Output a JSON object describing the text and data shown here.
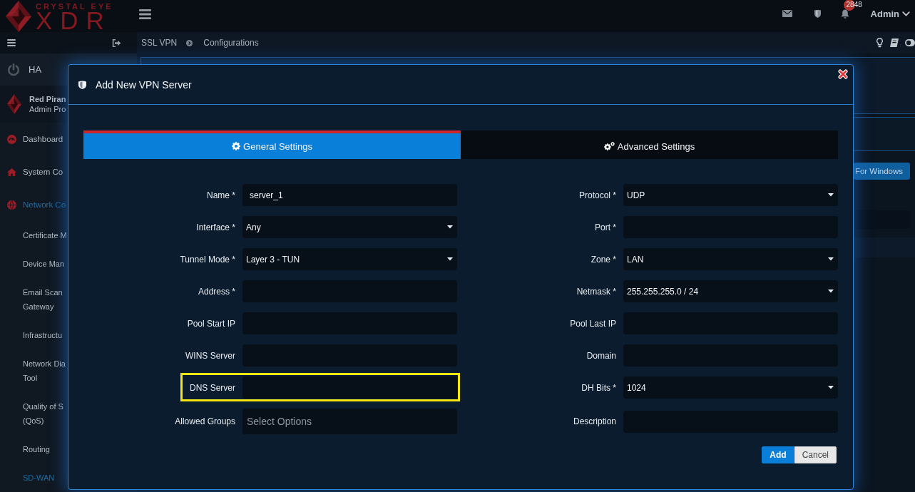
{
  "topbar": {
    "logo_tagline": "CRYSTAL EYE",
    "logo_wordmark": "XDR",
    "notification_count": "2848",
    "user_menu": "Admin"
  },
  "sidebar": {
    "status_item": "HA",
    "profile": {
      "name": "Red Piran",
      "role": "Admin Pro"
    },
    "menu": [
      {
        "label": "Dashboard",
        "selected": false
      },
      {
        "label": "System Co",
        "selected": false
      },
      {
        "label": "Network Co",
        "selected": true,
        "children": [
          {
            "lines": [
              "Certificate M"
            ],
            "selected": false
          },
          {
            "lines": [
              "Device Man"
            ],
            "selected": false
          },
          {
            "lines": [
              "Email Scan",
              "Gateway"
            ],
            "selected": false
          },
          {
            "lines": [
              "Infrastructu"
            ],
            "selected": false
          },
          {
            "lines": [
              "Network Dia",
              "Tool"
            ],
            "selected": false
          },
          {
            "lines": [
              "Quality of S",
              "(QoS)"
            ],
            "selected": false
          },
          {
            "lines": [
              "Routing"
            ],
            "selected": false
          },
          {
            "lines": [
              "SD-WAN"
            ],
            "selected": true
          }
        ]
      }
    ]
  },
  "breadcrumb": [
    "SSL VPN",
    "Configurations"
  ],
  "page": {
    "download_button": "For Windows"
  },
  "modal": {
    "title": "Add New VPN Server",
    "tabs": [
      {
        "label": "General Settings",
        "selected": true
      },
      {
        "label": "Advanced Settings",
        "selected": false
      }
    ],
    "left_fields": [
      {
        "label": "Name *",
        "kind": "text",
        "value": "server_1",
        "highlighted": false
      },
      {
        "label": "Interface *",
        "kind": "select",
        "value": "Any",
        "highlighted": false
      },
      {
        "label": "Tunnel Mode *",
        "kind": "select",
        "value": "Layer 3 - TUN",
        "highlighted": false
      },
      {
        "label": "Address *",
        "kind": "text",
        "highlighted": false
      },
      {
        "label": "Pool Start IP",
        "kind": "text",
        "highlighted": false
      },
      {
        "label": "WINS Server",
        "kind": "text",
        "highlighted": false
      },
      {
        "label": "DNS Server",
        "kind": "text",
        "highlighted": true
      },
      {
        "label": "Allowed Groups",
        "kind": "multiselect",
        "placeholder": "Select Options",
        "highlighted": false
      }
    ],
    "right_fields": [
      {
        "label": "Protocol *",
        "kind": "select",
        "value": "UDP",
        "highlighted": false
      },
      {
        "label": "Port *",
        "kind": "text",
        "highlighted": false
      },
      {
        "label": "Zone *",
        "kind": "select",
        "value": "LAN",
        "highlighted": false
      },
      {
        "label": "Netmask *",
        "kind": "select",
        "value": "255.255.255.0 / 24",
        "highlighted": false
      },
      {
        "label": "Pool Last IP",
        "kind": "text",
        "highlighted": false
      },
      {
        "label": "Domain",
        "kind": "text",
        "highlighted": false
      },
      {
        "label": "DH Bits *",
        "kind": "select",
        "value": "1024",
        "highlighted": false
      },
      {
        "label": "Description",
        "kind": "text",
        "highlighted": false
      }
    ],
    "buttons": [
      {
        "kind": "submit",
        "label": "Add"
      },
      {
        "kind": "cancel",
        "label": "Cancel"
      }
    ]
  }
}
